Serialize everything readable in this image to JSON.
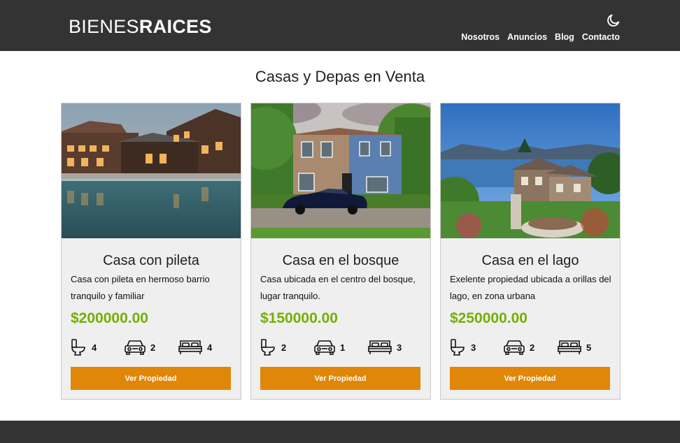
{
  "header": {
    "logo_light": "BIENES",
    "logo_bold": "RAICES",
    "theme_toggle_icon": "moon-icon",
    "nav": [
      "Nosotros",
      "Anuncios",
      "Blog",
      "Contacto"
    ]
  },
  "main": {
    "title": "Casas y Depas en Venta",
    "listings": [
      {
        "title": "Casa con pileta",
        "description": "Casa con pileta en hermoso barrio tranquilo y familiar",
        "price": "$200000.00",
        "bathrooms": "4",
        "parking": "2",
        "bedrooms": "4",
        "button": "Ver Propiedad",
        "image": "house-with-pool-photo"
      },
      {
        "title": "Casa en el bosque",
        "description": "Casa ubicada en el centro del bosque, lugar tranquilo.",
        "price": "$150000.00",
        "bathrooms": "2",
        "parking": "1",
        "bedrooms": "3",
        "button": "Ver Propiedad",
        "image": "house-in-forest-photo"
      },
      {
        "title": "Casa en el lago",
        "description": "Exelente propiedad ubicada a orillas del lago, en zona urbana",
        "price": "$250000.00",
        "bathrooms": "3",
        "parking": "2",
        "bedrooms": "5",
        "button": "Ver Propiedad",
        "image": "house-by-lake-photo"
      }
    ],
    "feature_icons": [
      "toilet-icon",
      "car-icon",
      "bed-icon"
    ]
  },
  "colors": {
    "header_bg": "#333333",
    "card_bg": "#efefef",
    "price": "#71b100",
    "button": "#e08709"
  }
}
